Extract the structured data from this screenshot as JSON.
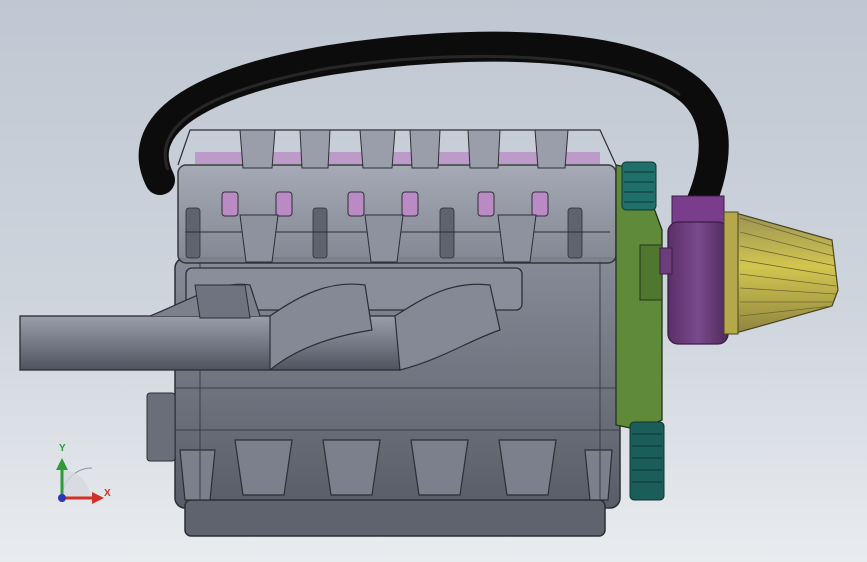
{
  "viewport": {
    "background_top": "#bfc7d2",
    "background_bottom": "#e9ecef"
  },
  "model": {
    "parts": [
      {
        "name": "engine-block",
        "color": "#6e7280"
      },
      {
        "name": "cylinder-head",
        "color": "#8a8f9c"
      },
      {
        "name": "intake-valves",
        "color": "#b98ac4"
      },
      {
        "name": "exhaust-manifold",
        "color": "#7c818e"
      },
      {
        "name": "exhaust-pipe",
        "color": "#7d818d"
      },
      {
        "name": "breather-hose",
        "color": "#111111"
      },
      {
        "name": "timing-cover",
        "color": "#5f8a3a"
      },
      {
        "name": "pulley",
        "color": "#1f6f6a"
      },
      {
        "name": "air-filter-housing",
        "color": "#6b3d7a"
      },
      {
        "name": "air-filter-cone",
        "color": "#c4b84a"
      }
    ]
  },
  "triad": {
    "x_label": "X",
    "y_label": "Y",
    "x_color": "#d2312a",
    "y_color": "#2f9a3a",
    "z_color": "#2a36b8"
  }
}
